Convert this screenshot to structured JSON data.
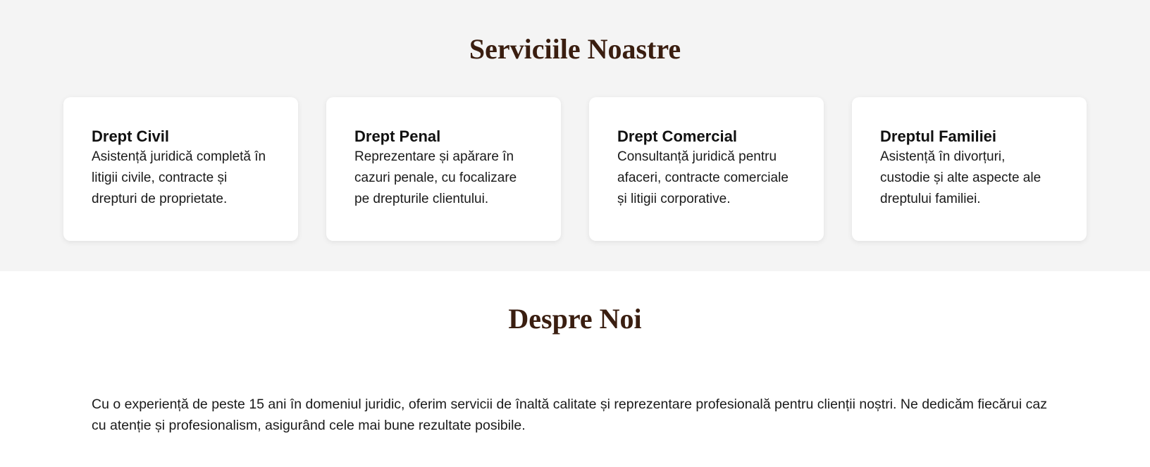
{
  "services": {
    "title": "Serviciile Noastre",
    "cards": [
      {
        "title": "Drept Civil",
        "text": "Asistență juridică completă în litigii civile, contracte și drepturi de proprietate."
      },
      {
        "title": "Drept Penal",
        "text": "Reprezentare și apărare în cazuri penale, cu focalizare pe drepturile clientului."
      },
      {
        "title": "Drept Comercial",
        "text": "Consultanță juridică pentru afaceri, contracte comerciale și litigii corporative."
      },
      {
        "title": "Dreptul Familiei",
        "text": "Asistență în divorțuri, custodie și alte aspecte ale dreptului familiei."
      }
    ]
  },
  "about": {
    "title": "Despre Noi",
    "text": "Cu o experiență de peste 15 ani în domeniul juridic, oferim servicii de înaltă calitate și reprezentare profesională pentru clienții noștri. Ne dedicăm fiecărui caz cu atenție și profesionalism, asigurând cele mai bune rezultate posibile."
  },
  "colors": {
    "heading": "#3a1e10",
    "section_bg": "#f4f4f4",
    "card_bg": "#ffffff"
  }
}
